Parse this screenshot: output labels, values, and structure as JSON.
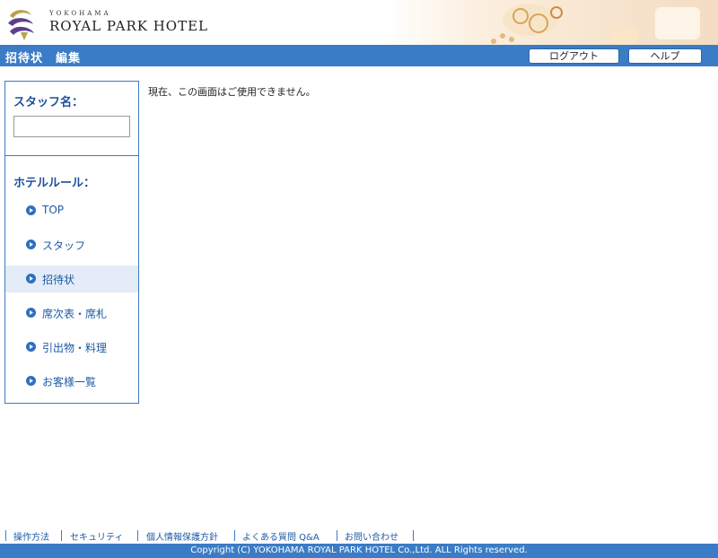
{
  "brand": {
    "top": "YOKOHAMA",
    "name": "ROYAL PARK HOTEL"
  },
  "titlebar": {
    "title": "招待状　編集",
    "logout_label": "ログアウト",
    "help_label": "ヘルプ"
  },
  "sidebar": {
    "staff_heading": "スタッフ名：",
    "staff_input_value": "",
    "rules_heading": "ホテルルール：",
    "items": [
      {
        "label": "TOP",
        "active": false
      },
      {
        "label": "スタッフ",
        "active": false
      },
      {
        "label": "招待状",
        "active": true
      },
      {
        "label": "席次表・席札",
        "active": false
      },
      {
        "label": "引出物・料理",
        "active": false
      },
      {
        "label": "お客様一覧",
        "active": false
      }
    ]
  },
  "main": {
    "message": "現在、この画面はご使用できません。"
  },
  "footer": {
    "links": [
      "操作方法",
      "セキュリティ",
      "個人情報保護方針",
      "よくある質問 Q&A",
      "お問い合わせ"
    ],
    "copyright": "Copyright (C) YOKOHAMA ROYAL PARK HOTEL Co.,Ltd. ALL Rights reserved."
  },
  "colors": {
    "accent": "#3a7cc6",
    "heading": "#1d4f9a",
    "link": "#1d5aa6",
    "active_bg": "#e3ecf7"
  }
}
